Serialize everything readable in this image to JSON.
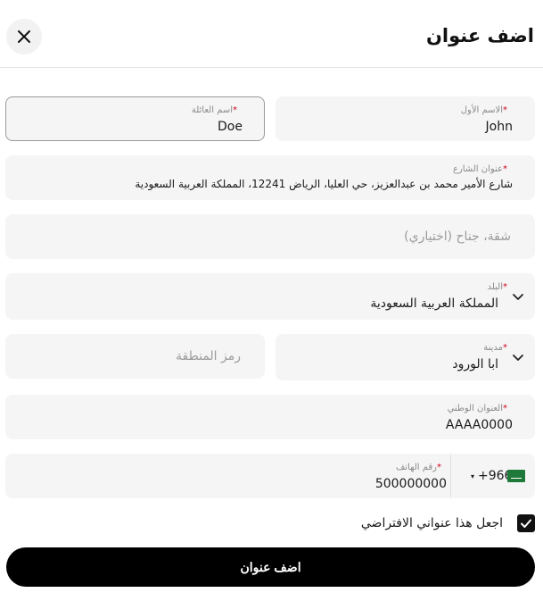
{
  "header": {
    "title": "اضف عنوان"
  },
  "form": {
    "first_name": {
      "label": "الاسم الأول",
      "value": "John"
    },
    "last_name": {
      "label": "اسم العائلة",
      "value": "Doe"
    },
    "street": {
      "label": "عنوان الشارع",
      "value": "شارع الأمير محمد بن عبدالعزيز، حي العليا، الرياض 12241، المملكة العربية السعودية"
    },
    "apartment": {
      "placeholder": "شقة، جناح (اختياري)"
    },
    "country": {
      "label": "البلد",
      "value": "المملكة العربية السعودية"
    },
    "city": {
      "label": "مدينة",
      "value": "ابا الورود"
    },
    "zip": {
      "placeholder": "رمز المنطقة"
    },
    "national_address": {
      "label": "العنوان الوطني",
      "value": "AAAA0000"
    },
    "phone": {
      "label": "رقم الهاتف",
      "value": "500000000",
      "country_code": "+966",
      "country_flag": "saudi-arabia-flag"
    },
    "default_address": {
      "label": "اجعل هذا عنواني الافتراضي",
      "checked": true
    }
  },
  "submit": {
    "label": "اضف عنوان"
  },
  "colors": {
    "required_star": "#d0021b",
    "button_bg": "#000000",
    "field_bg": "#f5f5f5",
    "flag_green": "#1f7a3a"
  }
}
